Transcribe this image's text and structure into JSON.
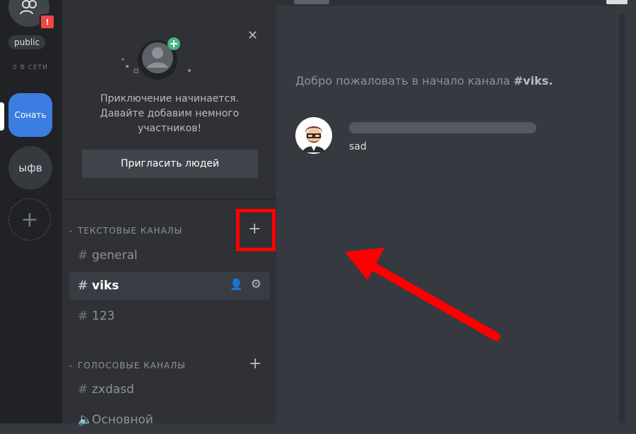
{
  "servers": {
    "public_tag": "public",
    "online_label": "0 В СЕТИ",
    "badge_count": "!",
    "items": [
      {
        "label": "Сонать",
        "active": true
      },
      {
        "label": "ыфв",
        "active": false
      }
    ],
    "add_label": "+"
  },
  "invite": {
    "text": "Приключение начинается. Давайте добавим немного участников!",
    "button": "Пригласить людей",
    "close": "✕"
  },
  "categories": [
    {
      "label": "ТЕКСТОВЫЕ КАНАЛЫ",
      "channels": [
        "general",
        "viks",
        "123"
      ]
    },
    {
      "label": "ГОЛОСОВЫЕ КАНАЛЫ",
      "channels": [
        "zxdasd",
        "Основной"
      ]
    }
  ],
  "main": {
    "welcome_prefix": "Добро пожаловать в начало канала",
    "welcome_channel": "#viks.",
    "message_text": "sad"
  }
}
